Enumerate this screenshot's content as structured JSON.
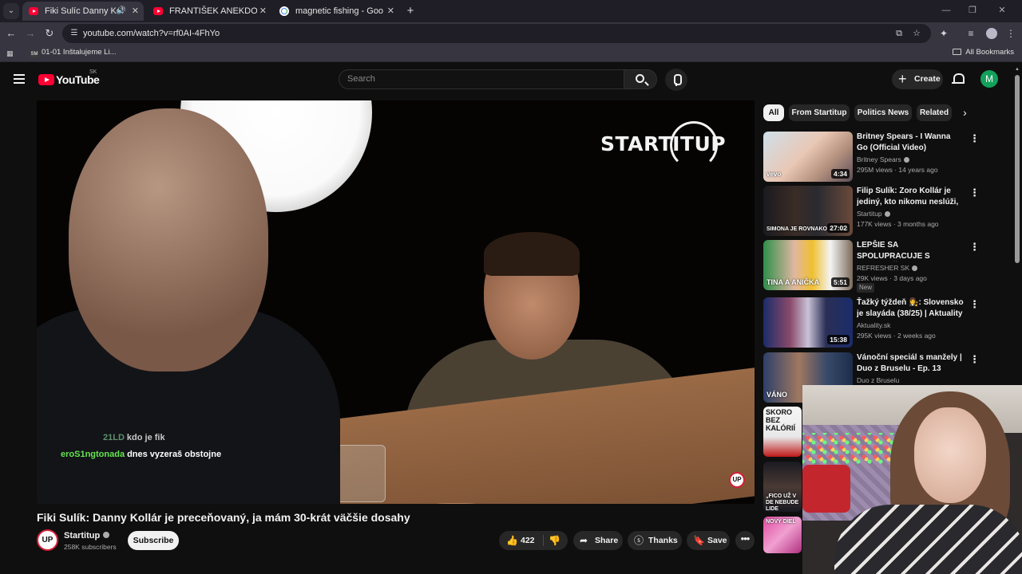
{
  "browser": {
    "tabs": [
      {
        "label": "Fiki Sulíc Danny Kollár je pr",
        "active": true,
        "audio": true
      },
      {
        "label": "FRANTIŠEK ANEKDOTA A JEHO",
        "active": false
      },
      {
        "label": "magnetic fishing - Google Sea",
        "active": false
      }
    ],
    "url": "youtube.com/watch?v=rf0AI-4FhYo",
    "bookmark": "01-01 Inštalujeme Li...",
    "bookmark_badge": "SM",
    "all_bookmarks": "All Bookmarks",
    "icons": {
      "tab_close": "✕",
      "new_tab": "+",
      "back": "←",
      "forward": "→",
      "reload": "↻",
      "star": "☆",
      "cast": "⧉",
      "extensions": "⧉",
      "menu": "⋮"
    }
  },
  "youtube": {
    "logo_text": "YouTube",
    "country": "SK",
    "search_placeholder": "Search",
    "create_label": "Create",
    "avatar_letter": "M",
    "accent": "#ff0033"
  },
  "player": {
    "brand": "STARTITUP",
    "watermark": "UP",
    "chat": [
      {
        "user": "21LD",
        "message": "kdo je fik"
      },
      {
        "user": "eroS1ngtonada",
        "message": "dnes vyzeraš obstojne"
      }
    ]
  },
  "video": {
    "title": "Fiki Sulík: Danny Kollár je preceňovaný, ja mám 30-krát väčšie dosahy",
    "channel": "Startitup",
    "channel_avatar": "UP",
    "subscribers": "258K subscribers",
    "subscribe_label": "Subscribe",
    "likes": "422",
    "share_label": "Share",
    "thanks_label": "Thanks",
    "save_label": "Save"
  },
  "chips": [
    "All",
    "From Startitup",
    "Politics News",
    "Related"
  ],
  "recommendations": [
    {
      "title": "Britney Spears - I Wanna Go (Official Video)",
      "channel": "Britney Spears",
      "verified": true,
      "meta": "295M views · 14 years ago",
      "duration": "4:34",
      "thumb_caption": "vevo",
      "new": false
    },
    {
      "title": "Filip Sulík: Zoro Kollár je jediný, kto nikomu neslúži, peniaze h...",
      "channel": "Startitup",
      "verified": true,
      "meta": "177K views · 3 months ago",
      "duration": "27:02",
      "thumb_caption": "SIMONA JE ROVNAKO ZLOMA",
      "new": false
    },
    {
      "title": "LEPŠIE SA SPOLUPRACUJE S MAMOU, ČI TATOM? Tina a ...",
      "channel": "REFRESHER SK",
      "verified": true,
      "meta": "29K views · 3 days ago",
      "duration": "5:51",
      "thumb_caption": "TINA A ANIČKA",
      "new": true,
      "new_label": "New"
    },
    {
      "title": "Ťažký týždeň 👩‍⚖️: Slovensko je slayáda (38/25) | Aktuality",
      "channel": "Aktuality.sk",
      "verified": false,
      "meta": "295K views · 2 weeks ago",
      "duration": "15:38",
      "thumb_caption": "",
      "new": false
    },
    {
      "title": "Vánoční speciál s manžely | Duo z Bruselu - Ep. 13",
      "channel": "Duo z Bruselu",
      "verified": false,
      "meta": "",
      "duration": "",
      "thumb_caption": "VÁNO",
      "new": false
    }
  ],
  "partial_thumbs": [
    {
      "caption": "SKORO BEZ KALÓRIÍ"
    },
    {
      "caption": "„FICO UŽ V DE NEBUDE LIDE"
    },
    {
      "caption": "NOVÝ DIEL"
    }
  ]
}
